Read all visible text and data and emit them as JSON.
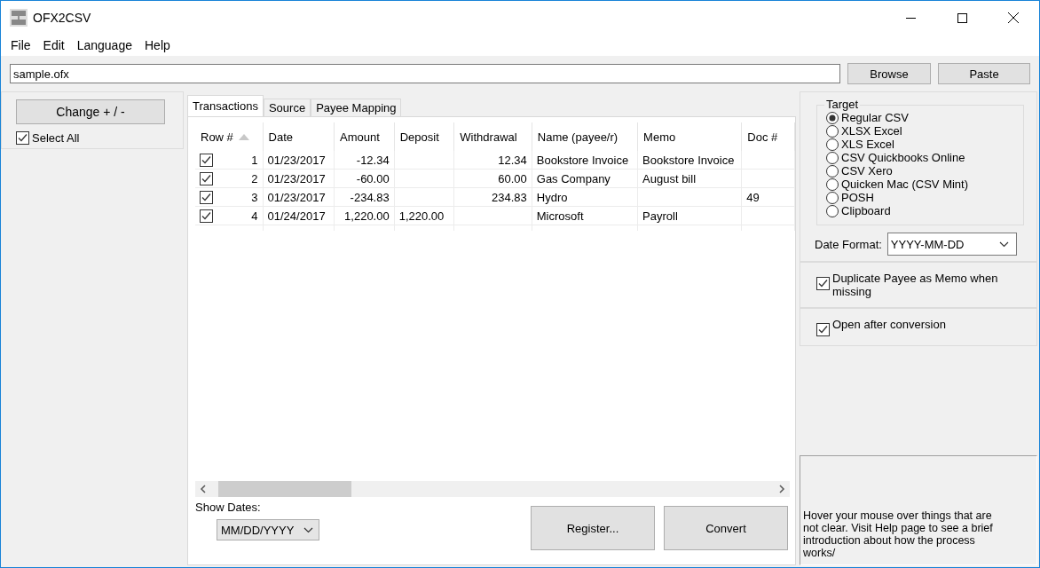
{
  "window": {
    "title": "OFX2CSV"
  },
  "menu": [
    "File",
    "Edit",
    "Language",
    "Help"
  ],
  "file_path": {
    "value": "sample.ofx"
  },
  "path_buttons": [
    "Browse",
    "Paste"
  ],
  "left_panel": {
    "change_button": "Change + / -",
    "select_all": {
      "label": "Select All",
      "checked": true
    }
  },
  "tabs": [
    {
      "label": "Transactions",
      "selected": true
    },
    {
      "label": "Source",
      "selected": false
    },
    {
      "label": "Payee Mapping",
      "selected": false
    }
  ],
  "table": {
    "columns": [
      {
        "label": "Row #",
        "kind": "numeric",
        "sorted": true
      },
      {
        "label": "Date",
        "kind": "text",
        "sorted": false
      },
      {
        "label": "Amount",
        "kind": "numeric",
        "sorted": false
      },
      {
        "label": "Deposit",
        "kind": "text",
        "sorted": false
      },
      {
        "label": "Withdrawal",
        "kind": "numeric",
        "sorted": false
      },
      {
        "label": "Name (payee/r)",
        "kind": "text",
        "sorted": false
      },
      {
        "label": "Memo",
        "kind": "text",
        "sorted": false
      },
      {
        "label": "Doc #",
        "kind": "text",
        "sorted": false
      }
    ],
    "rows": [
      {
        "checked": true,
        "cells": [
          "1",
          "01/23/2017",
          "-12.34",
          null,
          "12.34",
          "Bookstore Invoice",
          "Bookstore Invoice",
          null
        ]
      },
      {
        "checked": true,
        "cells": [
          "2",
          "01/23/2017",
          "-60.00",
          null,
          "60.00",
          "Gas Company",
          "August bill",
          null
        ]
      },
      {
        "checked": true,
        "cells": [
          "3",
          "01/23/2017",
          "-234.83",
          null,
          "234.83",
          "Hydro",
          null,
          "49"
        ]
      },
      {
        "checked": true,
        "cells": [
          "4",
          "01/24/2017",
          "1,220.00",
          "1,220.00",
          null,
          "Microsoft",
          "Payroll",
          null
        ]
      }
    ]
  },
  "show_dates": {
    "label": "Show Dates:",
    "value": "MM/DD/YYYY"
  },
  "action_buttons": [
    "Register...",
    "Convert"
  ],
  "target": {
    "title": "Target",
    "options": [
      {
        "label": "Regular CSV",
        "selected": true
      },
      {
        "label": "XLSX Excel",
        "selected": false
      },
      {
        "label": "XLS Excel",
        "selected": false
      },
      {
        "label": "CSV Quickbooks Online",
        "selected": false
      },
      {
        "label": "CSV Xero",
        "selected": false
      },
      {
        "label": "Quicken Mac (CSV Mint)",
        "selected": false
      },
      {
        "label": "POSH",
        "selected": false
      },
      {
        "label": "Clipboard",
        "selected": false
      }
    ]
  },
  "date_format": {
    "label": "Date Format:",
    "value": "YYYY-MM-DD"
  },
  "options": [
    {
      "label": "Duplicate Payee as Memo when missing",
      "checked": true
    },
    {
      "label": "Open after conversion",
      "checked": true
    }
  ],
  "help_text": "Hover your mouse over things that are not clear. Visit Help page to see a brief introduction about how the process works/"
}
